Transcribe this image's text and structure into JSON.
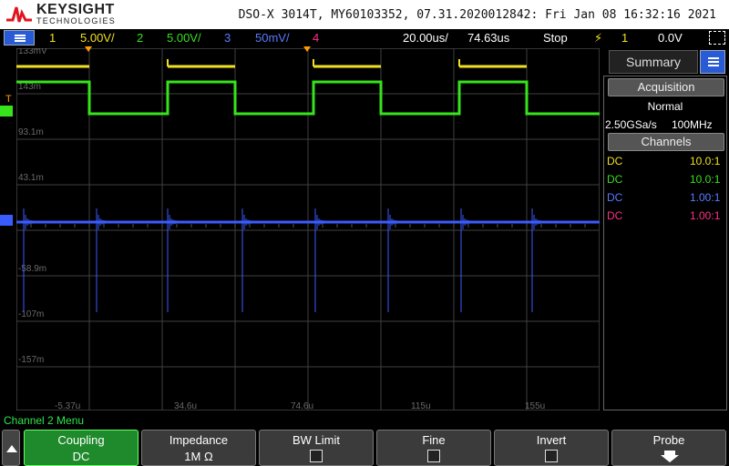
{
  "header": {
    "brand": "KEYSIGHT",
    "brand_sub": "TECHNOLOGIES",
    "title": "DSO-X 3014T, MY60103352, 07.31.2020012842: Fri Jan 08 16:32:16 2021"
  },
  "status": {
    "ch1_num": "1",
    "ch1_scale": "5.00V/",
    "ch2_num": "2",
    "ch2_scale": "5.00V/",
    "ch3_num": "3",
    "ch3_scale": "50mV/",
    "ch4_num": "4",
    "timebase": "20.00us/",
    "delay": "74.63us",
    "run_state": "Stop",
    "trig_ch": "1",
    "trig_level": "0.0V"
  },
  "grid": {
    "y_labels": [
      "133mV",
      "143m",
      "93.1m",
      "43.1m",
      "-58.9m",
      "-107m",
      "-157m"
    ],
    "x_labels": [
      "-5.37u",
      "34.6u",
      "74.6u",
      "115u",
      "155u"
    ],
    "trigger_marker": "T"
  },
  "colors": {
    "ch1": "#f0e020",
    "ch2": "#36e31c",
    "ch3": "#3a5cff",
    "ch4": "#ff2f86",
    "grid": "#404040",
    "accent_blue": "#2a5bd7"
  },
  "side": {
    "tab_label": "Summary",
    "acq_header": "Acquisition",
    "acq_mode": "Normal",
    "sample_rate": "2.50GSa/s",
    "bandwidth": "100MHz",
    "channels_header": "Channels",
    "channels": [
      {
        "coupling": "DC",
        "probe": "10.0:1"
      },
      {
        "coupling": "DC",
        "probe": "10.0:1"
      },
      {
        "coupling": "DC",
        "probe": "1.00:1"
      },
      {
        "coupling": "DC",
        "probe": "1.00:1"
      }
    ]
  },
  "menu": {
    "title": "Channel 2 Menu",
    "softkeys": [
      {
        "label": "Coupling",
        "value": "DC"
      },
      {
        "label": "Impedance",
        "value": "1M Ω"
      },
      {
        "label": "BW Limit"
      },
      {
        "label": "Fine"
      },
      {
        "label": "Invert"
      },
      {
        "label": "Probe"
      }
    ]
  }
}
